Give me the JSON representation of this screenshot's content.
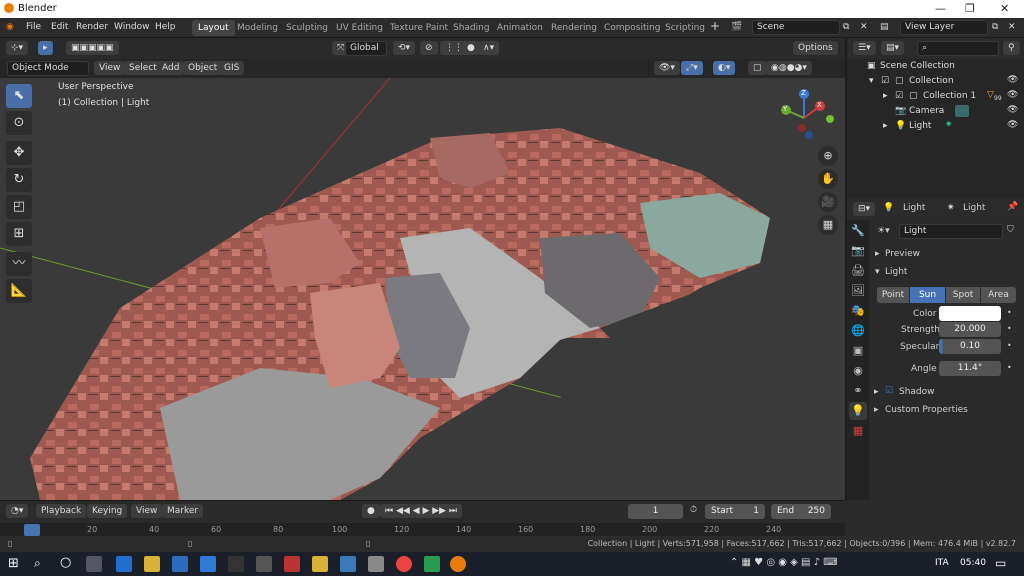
{
  "window": {
    "title": "Blender"
  },
  "menus": [
    "File",
    "Edit",
    "Render",
    "Window",
    "Help"
  ],
  "workspaces": [
    "Layout",
    "Modeling",
    "Sculpting",
    "UV Editing",
    "Texture Paint",
    "Shading",
    "Animation",
    "Rendering",
    "Compositing",
    "Scripting"
  ],
  "scene": {
    "label": "Scene",
    "view_layer": "View Layer"
  },
  "viewport_header": {
    "transform": "Global",
    "options": "Options",
    "mode": "Object Mode",
    "menus": [
      "View",
      "Select",
      "Add",
      "Object",
      "GIS"
    ]
  },
  "overlay": {
    "line1": "User Perspective",
    "line2": "(1) Collection | Light"
  },
  "gizmo": {
    "x": "X",
    "y": "Y",
    "z": "Z"
  },
  "outliner": {
    "items": [
      {
        "label": "Scene Collection"
      },
      {
        "label": "Collection"
      },
      {
        "label": "Collection 1",
        "badge": "99"
      },
      {
        "label": "Camera"
      },
      {
        "label": "Light"
      }
    ]
  },
  "properties": {
    "header_obj": "Light",
    "header_data": "Light",
    "name_field": "Light",
    "preview": "Preview",
    "light_panel": "Light",
    "types": [
      "Point",
      "Sun",
      "Spot",
      "Area"
    ],
    "selected_type": "Sun",
    "color_label": "Color",
    "strength_label": "Strength",
    "strength": "20.000",
    "specular_label": "Specular",
    "specular": "0.10",
    "angle_label": "Angle",
    "angle": "11.4°",
    "shadow": "Shadow",
    "custom": "Custom Properties"
  },
  "timeline": {
    "menus": [
      "Playback",
      "Keying",
      "View",
      "Marker"
    ],
    "current": "1",
    "start_label": "Start",
    "start": "1",
    "end_label": "End",
    "end": "250",
    "ticks": [
      "0",
      "20",
      "40",
      "60",
      "80",
      "100",
      "120",
      "140",
      "160",
      "180",
      "200",
      "220",
      "240"
    ]
  },
  "status": {
    "text": "Collection | Light | Verts:571,958 | Faces:517,662 | Tris:517,662 | Objects:0/396 | Mem: 476.4 MiB | v2.82.7"
  },
  "taskbar": {
    "lang": "ITA",
    "time": "05:40"
  },
  "colors": {
    "accent": "#4772b3",
    "header": "#2b2b2b",
    "viewport": "#3a3a3a"
  }
}
